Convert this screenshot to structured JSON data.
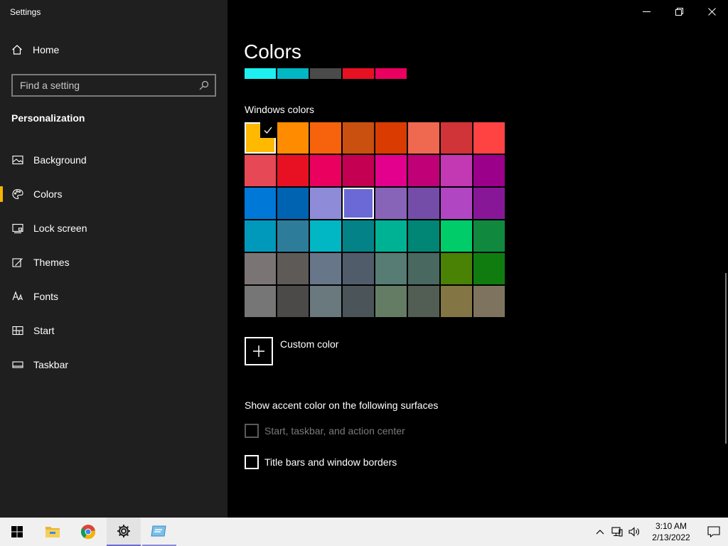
{
  "app": {
    "title": "Settings"
  },
  "sidebar": {
    "home_label": "Home",
    "search_placeholder": "Find a setting",
    "section_title": "Personalization",
    "items": [
      {
        "label": "Background",
        "icon": "picture-icon"
      },
      {
        "label": "Colors",
        "icon": "palette-icon",
        "active": true
      },
      {
        "label": "Lock screen",
        "icon": "lock-screen-icon"
      },
      {
        "label": "Themes",
        "icon": "themes-icon"
      },
      {
        "label": "Fonts",
        "icon": "fonts-icon"
      },
      {
        "label": "Start",
        "icon": "start-icon"
      },
      {
        "label": "Taskbar",
        "icon": "taskbar-icon"
      }
    ]
  },
  "main": {
    "title": "Colors",
    "recent_colors": [
      "#1ef0f0",
      "#00b7c3",
      "#4a4a4a",
      "#e81123",
      "#ea005e"
    ],
    "windows_colors_label": "Windows colors",
    "windows_colors": [
      "#ffb900",
      "#ff8c00",
      "#f7630c",
      "#ca5010",
      "#da3b01",
      "#ef6950",
      "#d13438",
      "#ff4343",
      "#e74856",
      "#e81123",
      "#ea005e",
      "#c30052",
      "#e3008c",
      "#bf0077",
      "#c239b3",
      "#9a0089",
      "#0078d7",
      "#0063b1",
      "#8e8cd8",
      "#6b69d6",
      "#8764b8",
      "#744da9",
      "#b146c2",
      "#881798",
      "#0099bc",
      "#2d7d9a",
      "#00b7c3",
      "#038387",
      "#00b294",
      "#018574",
      "#00cc6a",
      "#10893e",
      "#7a7574",
      "#5d5a58",
      "#68768a",
      "#515c6b",
      "#567c73",
      "#486860",
      "#498205",
      "#107c10",
      "#767676",
      "#4c4a48",
      "#69797e",
      "#4a5459",
      "#647c64",
      "#525e54",
      "#847545",
      "#7e735f"
    ],
    "selected_index": 0,
    "hovered_index": 19,
    "custom_color_label": "Custom color",
    "surfaces_label": "Show accent color on the following surfaces",
    "checkbox_start": "Start, taskbar, and action center",
    "checkbox_titlebars": "Title bars and window borders"
  },
  "taskbar": {
    "clock_time": "3:10 AM",
    "clock_date": "2/13/2022",
    "apps": [
      "windows-start-icon",
      "file-explorer-icon",
      "chrome-icon",
      "settings-gear-icon",
      "control-panel-icon"
    ]
  }
}
